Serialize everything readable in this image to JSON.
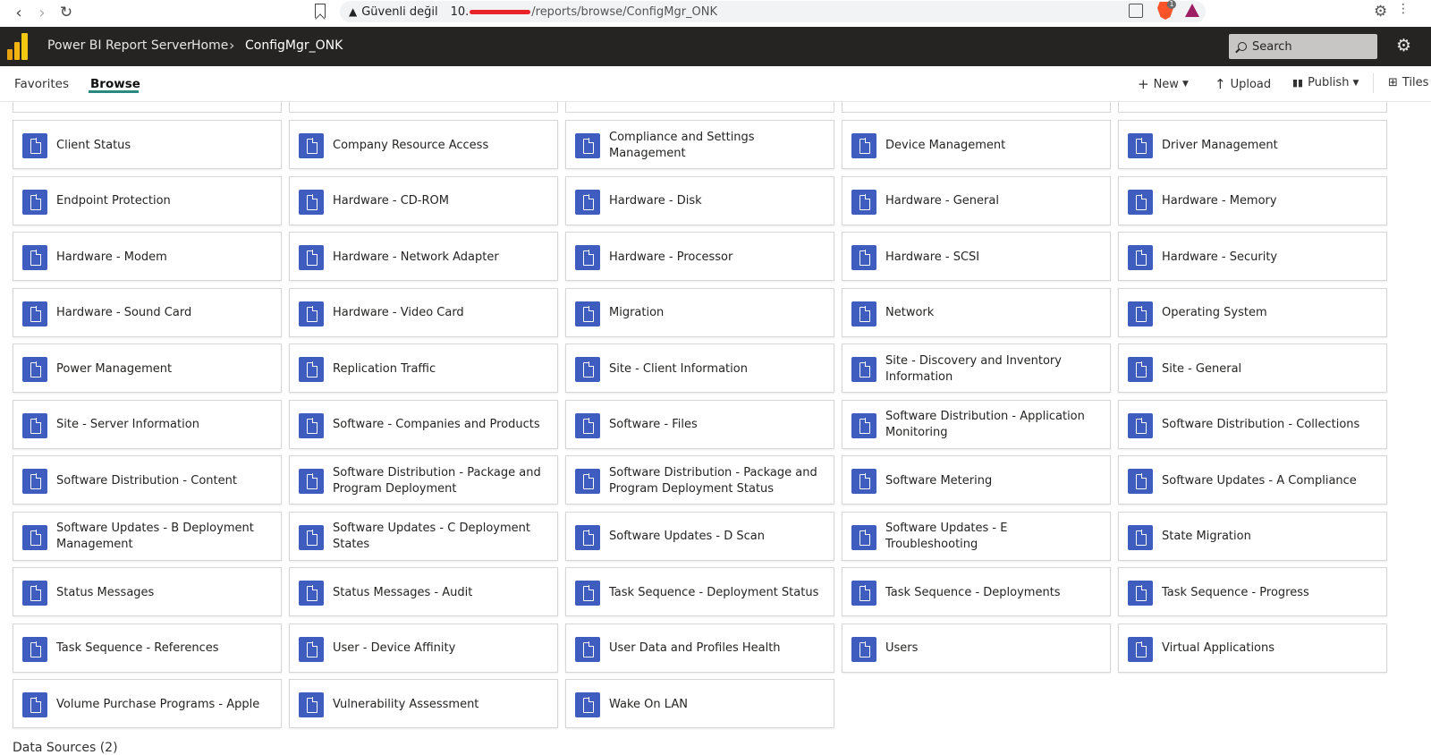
{
  "browser": {
    "insecure_label": "Güvenli değil",
    "url_host": "10.",
    "url_path": "/reports/browse/ConfigMgr_ONK",
    "brave_badge": "1"
  },
  "header": {
    "app_title": "Power BI Report Server",
    "breadcrumb_home": "Home",
    "breadcrumb_current": "ConfigMgr_ONK",
    "search_placeholder": "Search"
  },
  "subnav": {
    "tabs": [
      "Favorites",
      "Browse"
    ],
    "active_tab": "Browse",
    "toolbar": {
      "new_label": "New",
      "upload_label": "Upload",
      "publish_label": "Publish",
      "tiles_label": "Tiles"
    }
  },
  "folders": [
    "Client Status",
    "Company Resource Access",
    "Compliance and Settings Management",
    "Device Management",
    "Driver Management",
    "Endpoint Protection",
    "Hardware - CD-ROM",
    "Hardware - Disk",
    "Hardware - General",
    "Hardware - Memory",
    "Hardware - Modem",
    "Hardware - Network Adapter",
    "Hardware - Processor",
    "Hardware - SCSI",
    "Hardware - Security",
    "Hardware - Sound Card",
    "Hardware - Video Card",
    "Migration",
    "Network",
    "Operating System",
    "Power Management",
    "Replication Traffic",
    "Site - Client Information",
    "Site - Discovery and Inventory Information",
    "Site - General",
    "Site - Server Information",
    "Software - Companies and Products",
    "Software - Files",
    "Software Distribution - Application Monitoring",
    "Software Distribution - Collections",
    "Software Distribution - Content",
    "Software Distribution - Package and Program Deployment",
    "Software Distribution - Package and Program Deployment Status",
    "Software Metering",
    "Software Updates - A Compliance",
    "Software Updates - B Deployment Management",
    "Software Updates - C Deployment States",
    "Software Updates - D Scan",
    "Software Updates - E Troubleshooting",
    "State Migration",
    "Status Messages",
    "Status Messages - Audit",
    "Task Sequence - Deployment Status",
    "Task Sequence - Deployments",
    "Task Sequence - Progress",
    "Task Sequence - References",
    "User - Device Affinity",
    "User Data and Profiles Health",
    "Users",
    "Virtual Applications",
    "Volume Purchase Programs - Apple",
    "Vulnerability Assessment",
    "Wake On LAN"
  ],
  "data_sources_title": "Data Sources (2)",
  "colors": {
    "header_bg": "#252423",
    "tile_icon": "#3f5cbf",
    "tab_underline": "#2a8a82"
  }
}
